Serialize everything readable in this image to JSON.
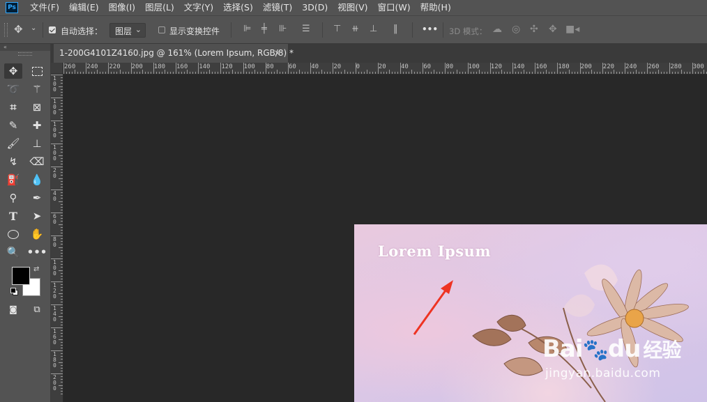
{
  "app": {
    "logo": "Ps"
  },
  "menu": [
    {
      "label": "文件(F)"
    },
    {
      "label": "编辑(E)"
    },
    {
      "label": "图像(I)"
    },
    {
      "label": "图层(L)"
    },
    {
      "label": "文字(Y)"
    },
    {
      "label": "选择(S)"
    },
    {
      "label": "滤镜(T)"
    },
    {
      "label": "3D(D)"
    },
    {
      "label": "视图(V)"
    },
    {
      "label": "窗口(W)"
    },
    {
      "label": "帮助(H)"
    }
  ],
  "options": {
    "auto_select_label": "自动选择：",
    "auto_select_checked": true,
    "layer_dropdown_value": "图层",
    "show_transform_label": "显示变换控件",
    "show_transform_checked": false,
    "more_label": "•••",
    "mode_3d_label": "3D 模式："
  },
  "document": {
    "tab_title": "1-200G4101Z4160.jpg @ 161% (Lorem Ipsum, RGB/8) *",
    "close_glyph": "×"
  },
  "ruler": {
    "h_labels": [
      "260",
      "240",
      "220",
      "200",
      "180",
      "160",
      "140",
      "120",
      "100",
      "80",
      "60",
      "40",
      "20",
      "0",
      "20",
      "40",
      "60",
      "80",
      "100",
      "120",
      "140",
      "160",
      "180",
      "200",
      "220",
      "240",
      "260",
      "280",
      "300"
    ],
    "v_labels": [
      "1 0 0",
      "1 0 0",
      "1 0 0",
      "1 0 0",
      "2 0",
      "4 0",
      "6 0",
      "8 0",
      "1 0 0",
      "1 2 0",
      "1 4 0",
      "1 6 0",
      "1 8 0",
      "2 0 0"
    ]
  },
  "tools": {
    "collapse_glyph": "«",
    "fg_color": "#000000",
    "bg_color": "#ffffff"
  },
  "image": {
    "overlay_text": "Lorem Ipsum",
    "watermark_brand": "Bai",
    "watermark_brand2": "du",
    "watermark_cn": "经验",
    "watermark_url": "jingyan.baidu.com",
    "arrow_color": "#ee3322"
  }
}
